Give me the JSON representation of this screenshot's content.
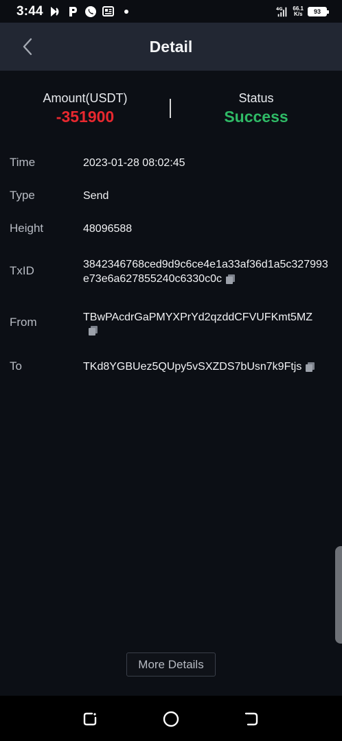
{
  "status_bar": {
    "time": "3:44",
    "network_speed_value": "66.1",
    "network_speed_unit": "K/s",
    "network_type": "4G",
    "battery": "93"
  },
  "header": {
    "title": "Detail"
  },
  "summary": {
    "amount_label": "Amount(USDT)",
    "amount_value": "-351900",
    "status_label": "Status",
    "status_value": "Success"
  },
  "details": {
    "time_label": "Time",
    "time_value": "2023-01-28 08:02:45",
    "type_label": "Type",
    "type_value": "Send",
    "height_label": "Height",
    "height_value": "48096588",
    "txid_label": "TxID",
    "txid_value": "3842346768ced9d9c6ce4e1a33af36d1a5c327993e73e6a627855240c6330c0c",
    "from_label": "From",
    "from_value": "TBwPAcdrGaPMYXPrYd2qzddCFVUFKmt5MZ",
    "to_label": "To",
    "to_value": "TKd8YGBUez5QUpy5vSXZDS7bUsn7k9Ftjs"
  },
  "more_details_label": "More Details",
  "colors": {
    "amount_negative": "#e8282f",
    "status_success": "#2fba66",
    "header_bg": "#222733",
    "page_bg": "#0c0f15"
  }
}
